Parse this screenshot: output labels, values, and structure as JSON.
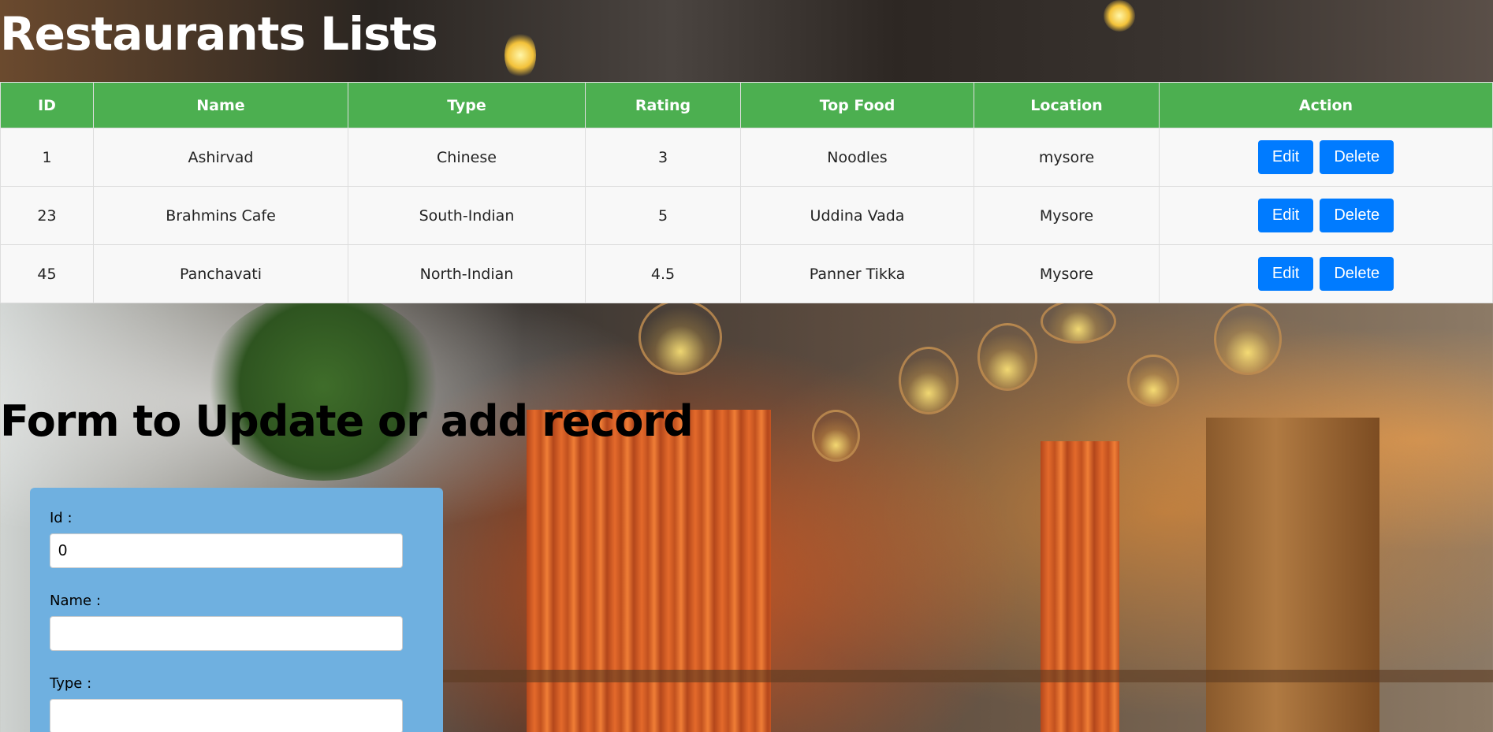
{
  "page_title": "Restaurants Lists",
  "table": {
    "headers": [
      "ID",
      "Name",
      "Type",
      "Rating",
      "Top Food",
      "Location",
      "Action"
    ],
    "rows": [
      {
        "id": "1",
        "name": "Ashirvad",
        "type": "Chinese",
        "rating": "3",
        "top_food": "Noodles",
        "location": "mysore"
      },
      {
        "id": "23",
        "name": "Brahmins Cafe",
        "type": "South-Indian",
        "rating": "5",
        "top_food": "Uddina Vada",
        "location": "Mysore"
      },
      {
        "id": "45",
        "name": "Panchavati",
        "type": "North-Indian",
        "rating": "4.5",
        "top_food": "Panner Tikka",
        "location": "Mysore"
      }
    ],
    "edit_label": "Edit",
    "delete_label": "Delete"
  },
  "form": {
    "title": "Form to Update or add record",
    "id_label": "Id :",
    "id_value": "0",
    "name_label": "Name :",
    "name_value": "",
    "type_label": "Type :",
    "type_value": ""
  },
  "colors": {
    "header_green": "#4caf50",
    "button_blue": "#007bff",
    "form_card_blue": "#6fb0e0"
  }
}
